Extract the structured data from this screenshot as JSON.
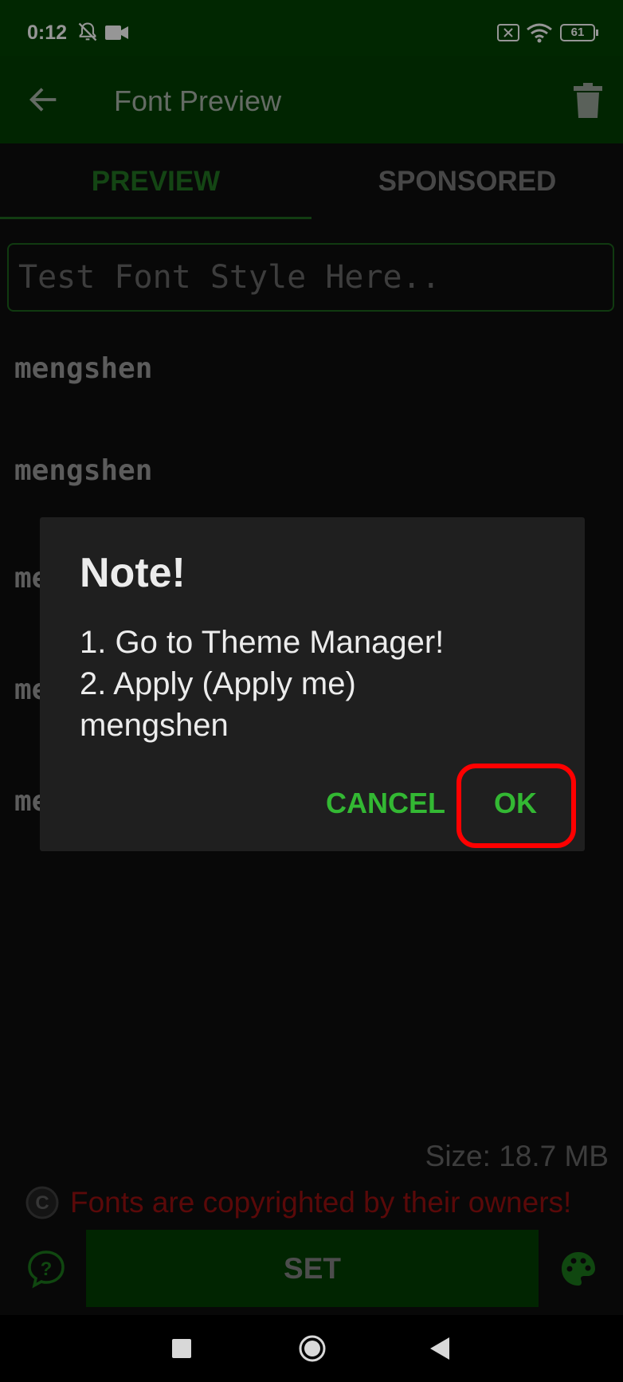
{
  "status_bar": {
    "time": "0:12",
    "battery": "61",
    "icons": [
      "notifications-off-icon",
      "video-camera-icon",
      "sim-off-icon",
      "wifi-icon",
      "battery-icon"
    ]
  },
  "app_bar": {
    "title": "Font Preview",
    "back_icon": "arrow-back-icon",
    "delete_icon": "trash-icon"
  },
  "tabs": [
    {
      "label": "PREVIEW",
      "active": true
    },
    {
      "label": "SPONSORED",
      "active": false
    }
  ],
  "test_input": {
    "placeholder": "Test Font Style Here..",
    "value": ""
  },
  "samples": [
    "mengshen",
    "mengshen",
    "mengshen",
    "mengshen",
    "mengshen"
  ],
  "dialog": {
    "title": "Note!",
    "lines": [
      "1. Go to Theme Manager!",
      "2. Apply (Apply me)",
      "mengshen"
    ],
    "cancel_label": "CANCEL",
    "ok_label": "OK"
  },
  "footer": {
    "size_text": "Size: 18.7 MB",
    "copyright_text": "Fonts are copyrighted by their owners!",
    "set_label": "SET",
    "help_icon": "help-icon",
    "palette_icon": "palette-icon"
  },
  "colors": {
    "primary_dark": "#023d02",
    "accent": "#33b833",
    "highlight": "#ff0000",
    "copyright_text": "#8b0f0f"
  },
  "nav_bar": {
    "icons": [
      "recents-icon",
      "home-icon",
      "back-icon"
    ]
  }
}
